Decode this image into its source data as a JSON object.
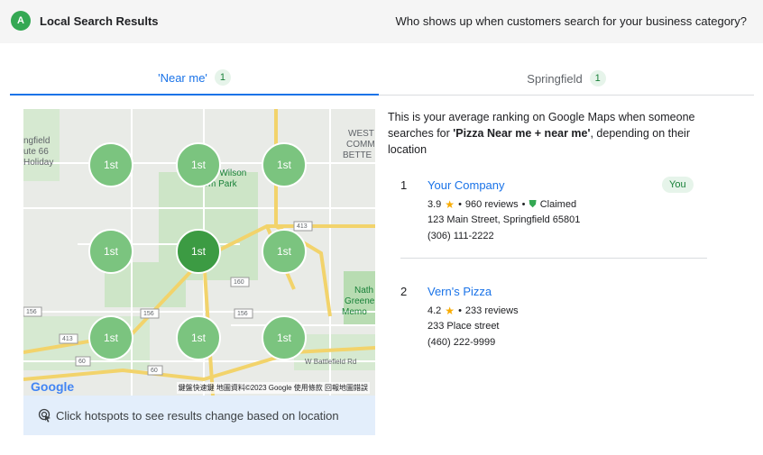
{
  "header": {
    "badge": "A",
    "title": "Local Search Results",
    "question": "Who shows up when customers search for your business category?"
  },
  "tabs": [
    {
      "label": "'Near me'",
      "count": "1"
    },
    {
      "label": "Springfield",
      "count": "1"
    }
  ],
  "map": {
    "hotspot_label": "1st",
    "place_labels": [
      "ngfield",
      "ute 66",
      "Holiday",
      "Rutledge-Wilson",
      "Farm Park",
      "WEST",
      "COMM",
      "BETTE",
      "Nath",
      "Greene",
      "Memo",
      "W Battlefield Rd"
    ],
    "road_numbers": [
      "413",
      "160",
      "156",
      "156",
      "156",
      "413",
      "60",
      "60"
    ],
    "logo": "Google",
    "attribution": "鍵盤快速鍵   地圖資料©2023 Google   使用條款   回報地圖錯誤"
  },
  "hint": "Click hotspots to see results change based on location",
  "description": {
    "prefix": "This is your average ranking on Google Maps when someone searches for ",
    "query": "'Pizza Near me + near me'",
    "suffix": ", depending on their location"
  },
  "results": [
    {
      "rank": "1",
      "name": "Your Company",
      "rating": "3.9",
      "reviews": "960 reviews",
      "claimed": "Claimed",
      "address": "123 Main Street, Springfield 65801",
      "phone": "(306) 111-2222",
      "badge": "You"
    },
    {
      "rank": "2",
      "name": "Vern's Pizza",
      "rating": "4.2",
      "reviews": "233 reviews",
      "address": "233 Place street",
      "phone": "(460) 222-9999"
    }
  ],
  "colors": {
    "accent": "#1a73e8",
    "hotspot": "#7bc47f",
    "hotspot_center": "#3c9b43",
    "badge_green": "#34a853"
  }
}
